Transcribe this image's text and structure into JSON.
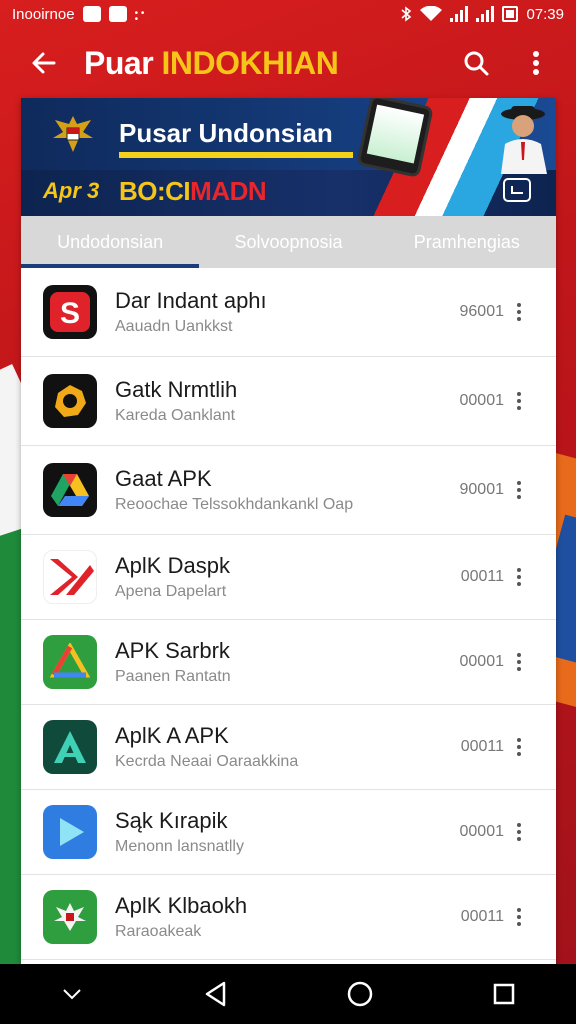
{
  "status_bar": {
    "carrier": "Inooirnoe",
    "time": "07:39"
  },
  "app_bar": {
    "title_white": "Puar ",
    "title_yellow": "INDOKHIAN"
  },
  "banner": {
    "title": "Pusar Undonsian",
    "left_text": "Apr 3",
    "promo_yellow": "BO:CI",
    "promo_red": "MADN"
  },
  "tabs": [
    {
      "label": "Undodonsian",
      "active": true
    },
    {
      "label": "Solvoopnosia",
      "active": false
    },
    {
      "label": "Pramhengias",
      "active": false
    }
  ],
  "apps": [
    {
      "name": "Dar Indant aphı",
      "subtitle": "Aauadn Uankkst",
      "count": "96001",
      "icon": "s-red-icon",
      "bg": "#111111"
    },
    {
      "name": "Gatk Nrmtlih",
      "subtitle": "Kareda Oanklant",
      "count": "00001",
      "icon": "gear-gold-icon",
      "bg": "#111111"
    },
    {
      "name": "Gaat APK",
      "subtitle": "Reoochae Telssokhdankankl Oap",
      "count": "90001",
      "icon": "drive-triangle-icon",
      "bg": "#111111"
    },
    {
      "name": "AplK Daspk",
      "subtitle": "Apena Dapelart",
      "count": "00011",
      "icon": "red-chevron-icon",
      "bg": "#ffffff"
    },
    {
      "name": "APK Sarbrk",
      "subtitle": "Paanen Rantatn",
      "count": "00001",
      "icon": "green-triangle-icon",
      "bg": "#2e9e3e"
    },
    {
      "name": "AplK A APK",
      "subtitle": "Kecrda Neaai Oaraakkina",
      "count": "00011",
      "icon": "teal-a-icon",
      "bg": "#0f4a3a"
    },
    {
      "name": "Sąk Kırapik",
      "subtitle": "Menonn lansnatlly",
      "count": "00001",
      "icon": "play-blue-icon",
      "bg": "#2f7de0"
    },
    {
      "name": "AplK Klbaokh",
      "subtitle": "Raraoakeak",
      "count": "00011",
      "icon": "garuda-green-icon",
      "bg": "#2e9e3e"
    }
  ]
}
